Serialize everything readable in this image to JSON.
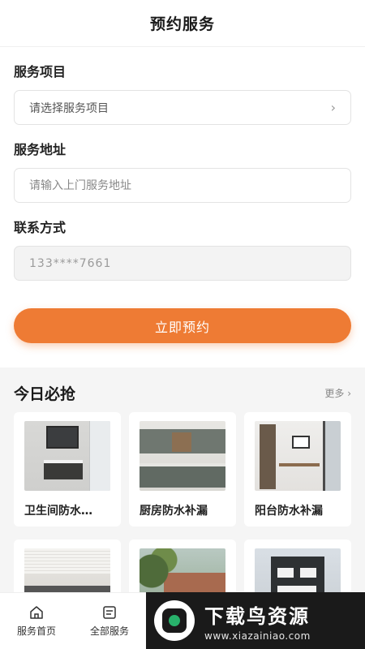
{
  "header": {
    "title": "预约服务"
  },
  "form": {
    "service_item": {
      "label": "服务项目",
      "value": "请选择服务项目"
    },
    "address": {
      "label": "服务地址",
      "placeholder": "请输入上门服务地址"
    },
    "contact": {
      "label": "联系方式",
      "value": "133****7661"
    },
    "submit_label": "立即预约"
  },
  "deals": {
    "title": "今日必抢",
    "more_label": "更多 ›",
    "items": [
      {
        "title": "卫生间防水…"
      },
      {
        "title": "厨房防水补漏"
      },
      {
        "title": "阳台防水补漏"
      },
      {
        "title": ""
      },
      {
        "title": ""
      },
      {
        "title": ""
      }
    ]
  },
  "bottom_nav": [
    {
      "label": "服务首页",
      "icon": "home-icon"
    },
    {
      "label": "全部服务",
      "icon": "list-icon"
    }
  ],
  "watermark": {
    "title": "下载鸟资源",
    "url": "www.xiazainiao.com"
  }
}
